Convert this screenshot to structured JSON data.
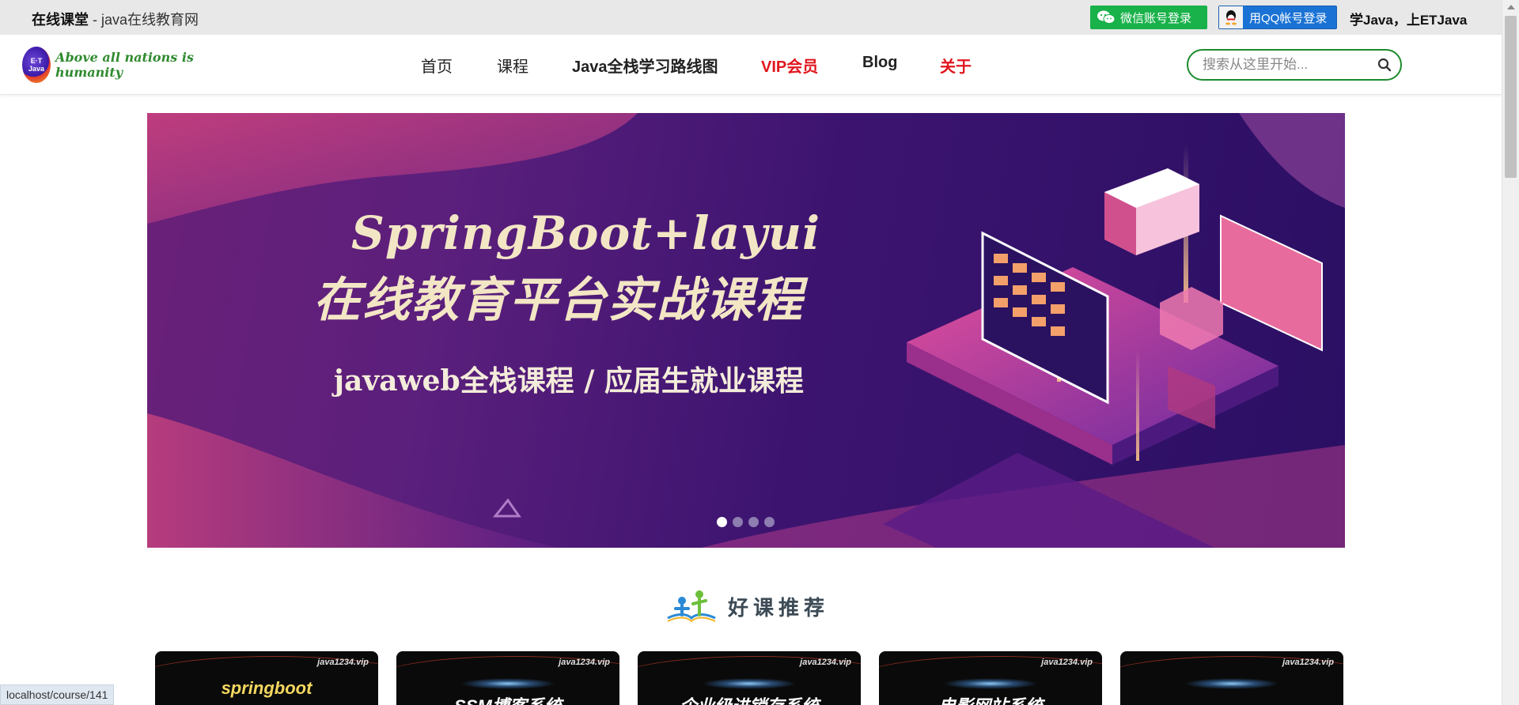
{
  "topbar": {
    "site_name_bold": "在线课堂",
    "site_name_rest": " - java在线教育网",
    "wechat_login": "微信账号登录",
    "qq_login": "用QQ帐号登录",
    "slogan": "学Java，上ETJava"
  },
  "nav": {
    "logo_badge": "E·T Java",
    "logo_text": "Above all nations is humanity",
    "items": [
      "首页",
      "课程",
      "Java全栈学习路线图",
      "VIP会员",
      "Blog",
      "关于"
    ],
    "search_placeholder": "搜索从这里开始..."
  },
  "banner": {
    "title": "SpringBoot+layui",
    "subtitle": "在线教育平台实战课程",
    "tagline": "javaweb全栈课程 / 应届生就业课程",
    "slide_count": 4,
    "active_slide": 1
  },
  "recommend": {
    "heading": "好课推荐",
    "cards": [
      {
        "brand": "java1234.vip",
        "title": "springboot"
      },
      {
        "brand": "java1234.vip",
        "title": "SSM博客系统"
      },
      {
        "brand": "java1234.vip",
        "title": "企业级进销存系统"
      },
      {
        "brand": "java1234.vip",
        "title": "电影网站系统"
      },
      {
        "brand": "java1234.vip",
        "title": ""
      }
    ]
  },
  "status_url": "localhost/course/141",
  "colors": {
    "brand_green": "#1c8b2c",
    "vip_red": "#e0161e",
    "wechat_green": "#19b14a",
    "qq_blue": "#1a72d4"
  }
}
